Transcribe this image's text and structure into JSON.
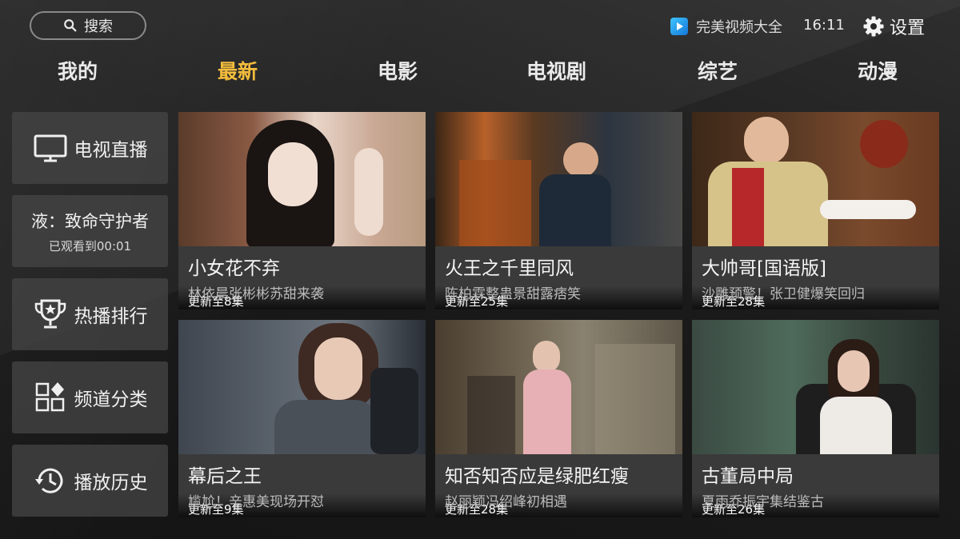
{
  "search": {
    "label": "搜索",
    "icon": "search-icon"
  },
  "brand": {
    "name": "完美视频大全",
    "time": "16:11"
  },
  "settings": {
    "label": "设置",
    "icon": "gear-icon"
  },
  "tabs": [
    {
      "label": "我的",
      "active": false
    },
    {
      "label": "最新",
      "active": true
    },
    {
      "label": "电影",
      "active": false
    },
    {
      "label": "电视剧",
      "active": false
    },
    {
      "label": "综艺",
      "active": false
    },
    {
      "label": "动漫",
      "active": false
    }
  ],
  "colors": {
    "active_tab": "#f4bd3c",
    "card_bg": "#3a3a3a",
    "sidebar_bg": "#474747"
  },
  "sidebar": {
    "live": {
      "label": "电视直播",
      "icon": "tv-icon"
    },
    "resume": {
      "title": "液：致命守护者",
      "progress": "已观看到00:01"
    },
    "ranking": {
      "label": "热播排行",
      "icon": "trophy-icon"
    },
    "category": {
      "label": "频道分类",
      "icon": "grid-icon"
    },
    "history": {
      "label": "播放历史",
      "icon": "history-icon"
    }
  },
  "cards": [
    {
      "badge": "更新至8集",
      "title": "小女花不弃",
      "subtitle": "林依晨张彬彬苏甜来袭"
    },
    {
      "badge": "更新至25集",
      "title": "火王之千里同风",
      "subtitle": "陈柏霖整蛊景甜露痞笑"
    },
    {
      "badge": "更新至28集",
      "title": "大帅哥[国语版]",
      "subtitle": "沙雕预警！张卫健爆笑回归"
    },
    {
      "badge": "更新至9集",
      "title": "幕后之王",
      "subtitle": "尴尬！辛惠美现场开怼"
    },
    {
      "badge": "更新至28集",
      "title": "知否知否应是绿肥红瘦",
      "subtitle": "赵丽颖冯绍峰初相遇"
    },
    {
      "badge": "更新至26集",
      "title": "古董局中局",
      "subtitle": "夏雨乔振宇集结鉴古"
    }
  ]
}
